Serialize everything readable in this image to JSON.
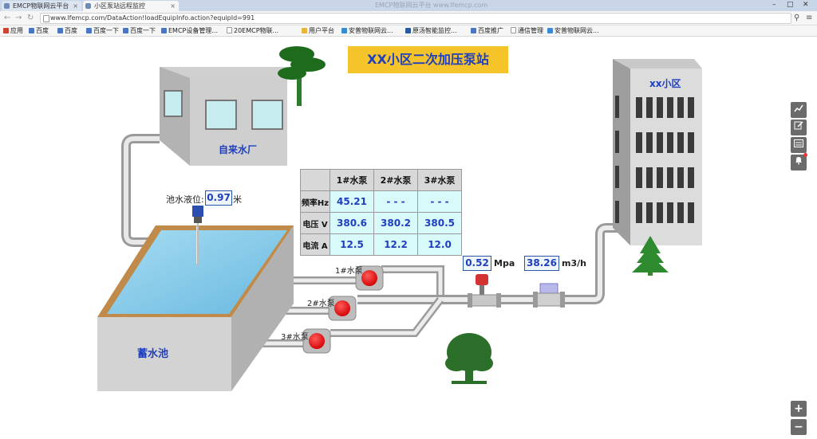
{
  "browser": {
    "tabs": [
      {
        "label": "EMCP物联网云平台"
      },
      {
        "label": "小区泵站远程监控"
      }
    ],
    "blurred_title": "EMCP物联网云平台 www.lfemcp.com",
    "url": "www.lfemcp.com/DataAction!loadEquipInfo.action?equipId=991",
    "bookmarks": [
      "应用",
      "百度",
      "百度",
      "百度一下",
      "百度一下",
      "EMCP设备管理...",
      "20EMCP物联...",
      "用户平台",
      "安普物联网云...",
      "原汤智能监控...",
      "百度推广",
      "通信管理",
      "安普物联网云..."
    ]
  },
  "scene": {
    "title": "XX小区二次加压泵站",
    "waterworks_label": "自来水厂",
    "reservoir_label": "蓄水池",
    "building_label": "xx小区",
    "level": {
      "label": "池水液位:",
      "value": "0.97",
      "unit": "米"
    },
    "pressure": {
      "value": "0.52",
      "unit": "Mpa"
    },
    "flow": {
      "value": "38.26",
      "unit": "m3/h"
    },
    "pumps": [
      "1#水泵",
      "2#水泵",
      "3#水泵"
    ],
    "table": {
      "headers": [
        "",
        "1#水泵",
        "2#水泵",
        "3#水泵"
      ],
      "rows": [
        {
          "label": "频率Hz",
          "values": [
            "45.21",
            "- - -",
            "- - -"
          ]
        },
        {
          "label": "电压 V",
          "values": [
            "380.6",
            "380.2",
            "380.5"
          ]
        },
        {
          "label": "电流 A",
          "values": [
            "12.5",
            "12.2",
            "12.0"
          ]
        }
      ]
    }
  },
  "side_buttons": [
    "chart-icon",
    "edit-icon",
    "list-icon",
    "bell-icon"
  ],
  "zoom": {
    "in": "+",
    "out": "−"
  },
  "colors": {
    "title_bg": "#f5c32a",
    "title_text": "#1f3fbf",
    "value_text": "#1f3fbf",
    "pump_red": "#e81818",
    "water": "#7ec8e8"
  }
}
